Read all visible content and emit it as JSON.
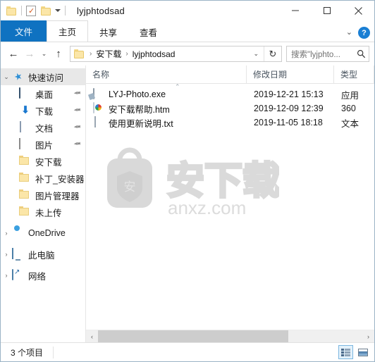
{
  "window": {
    "title": "lyjphtodsad",
    "quick_access_toolbar": [
      {
        "name": "folder-icon",
        "label": ""
      },
      {
        "name": "properties-icon",
        "label": ""
      },
      {
        "name": "new-folder-icon",
        "label": ""
      },
      {
        "name": "customize-qat-caret-icon",
        "label": ""
      }
    ],
    "controls": {
      "minimize": "minimize-icon",
      "maximize": "maximize-icon",
      "close": "close-icon"
    }
  },
  "ribbon": {
    "tabs": [
      {
        "label": "文件",
        "active": true
      },
      {
        "label": "主页",
        "active": false
      },
      {
        "label": "共享",
        "active": false
      },
      {
        "label": "查看",
        "active": false
      }
    ],
    "expand_label": "⌄",
    "help_label": "?"
  },
  "address": {
    "back_label": "←",
    "forward_label": "→",
    "recent_label": "⌄",
    "up_label": "↑",
    "breadcrumbs": [
      "安下载",
      "lyjphtodsad"
    ],
    "separator": "›",
    "dropdown_label": "⌄",
    "refresh_label": "↻"
  },
  "search": {
    "placeholder": "搜索\"lyjphto...",
    "icon": "search-icon"
  },
  "sidebar": {
    "items": [
      {
        "label": "快速访问",
        "icon": "star-pin-icon",
        "chevron": "⌄",
        "indent": 0,
        "pinned": false,
        "selected": true
      },
      {
        "label": "桌面",
        "icon": "desktop-icon",
        "chevron": "",
        "indent": 1,
        "pinned": true,
        "selected": false
      },
      {
        "label": "下载",
        "icon": "download-icon",
        "chevron": "",
        "indent": 1,
        "pinned": true,
        "selected": false
      },
      {
        "label": "文档",
        "icon": "documents-icon",
        "chevron": "",
        "indent": 1,
        "pinned": true,
        "selected": false
      },
      {
        "label": "图片",
        "icon": "pictures-icon",
        "chevron": "",
        "indent": 1,
        "pinned": true,
        "selected": false
      },
      {
        "label": "安下载",
        "icon": "folder-icon",
        "chevron": "",
        "indent": 1,
        "pinned": false,
        "selected": false
      },
      {
        "label": "补丁_安装器",
        "icon": "folder-icon",
        "chevron": "",
        "indent": 1,
        "pinned": false,
        "selected": false
      },
      {
        "label": "图片管理器",
        "icon": "folder-icon",
        "chevron": "",
        "indent": 1,
        "pinned": false,
        "selected": false
      },
      {
        "label": "未上传",
        "icon": "folder-icon",
        "chevron": "",
        "indent": 1,
        "pinned": false,
        "selected": false
      },
      {
        "label": "OneDrive",
        "icon": "onedrive-icon",
        "chevron": "›",
        "indent": 0,
        "pinned": false,
        "selected": false
      },
      {
        "label": "此电脑",
        "icon": "this-pc-icon",
        "chevron": "›",
        "indent": 0,
        "pinned": false,
        "selected": false
      },
      {
        "label": "网络",
        "icon": "network-icon",
        "chevron": "›",
        "indent": 0,
        "pinned": false,
        "selected": false
      }
    ],
    "pin_glyph": "📌"
  },
  "filelist": {
    "columns": [
      {
        "label": "名称",
        "key": "name"
      },
      {
        "label": "修改日期",
        "key": "date"
      },
      {
        "label": "类型",
        "key": "type"
      }
    ],
    "sort_indicator": "⌃",
    "rows": [
      {
        "name": "LYJ-Photo.exe",
        "date": "2019-12-21 15:13",
        "type": "应用",
        "icon": "exe-icon"
      },
      {
        "name": "安下载帮助.htm",
        "date": "2019-12-09 12:39",
        "type": "360",
        "icon": "360-browser-icon"
      },
      {
        "name": "使用更新说明.txt",
        "date": "2019-11-05 18:18",
        "type": "文本",
        "icon": "text-document-icon"
      }
    ]
  },
  "watermark": {
    "shield_text": "安",
    "brand_text": "安下载",
    "domain_text": "anxz.com",
    "color": "#d8d8d8"
  },
  "scrollbar": {
    "left_label": "‹",
    "right_label": "›"
  },
  "statusbar": {
    "item_count": "3 个项目",
    "view_details": "details-view-icon",
    "view_large_icons": "large-icons-view-icon"
  },
  "colors": {
    "accent": "#0f72c1",
    "window_border": "#9ab3c6",
    "text": "#1b1b1b"
  }
}
